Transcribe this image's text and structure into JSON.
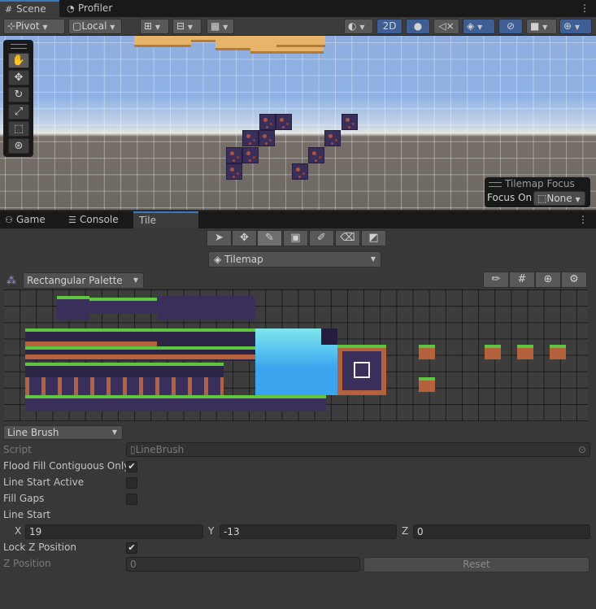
{
  "scene_tabs": [
    {
      "label": "Scene",
      "icon": "grid-icon"
    },
    {
      "label": "Profiler",
      "icon": "profiler-icon"
    }
  ],
  "scene_toolbar": {
    "pivot_label": "Pivot",
    "local_label": "Local",
    "mode_2d_label": "2D"
  },
  "tilemap_focus": {
    "title": "Tilemap Focus",
    "label": "Focus On",
    "value": "None"
  },
  "bottom_tabs": [
    {
      "label": "Game",
      "icon": "gamepad-icon"
    },
    {
      "label": "Console",
      "icon": "console-icon"
    },
    {
      "label": "Tile Palette",
      "icon": ""
    }
  ],
  "palette": {
    "tools": [
      "select-icon",
      "move-icon",
      "brush-icon",
      "box-fill-icon",
      "picker-icon",
      "eraser-icon",
      "fill-icon"
    ],
    "active_tilemap": "Tilemap",
    "palette_name": "Rectangular Palette"
  },
  "inspector": {
    "brush_name": "Line Brush",
    "script_label": "Script",
    "script_value": "LineBrush",
    "flood_fill_label": "Flood Fill Contiguous Only",
    "flood_fill_checked": true,
    "line_start_active_label": "Line Start Active",
    "line_start_active_checked": false,
    "fill_gaps_label": "Fill Gaps",
    "fill_gaps_checked": false,
    "line_start_label": "Line Start",
    "x_label": "X",
    "x_value": "19",
    "y_label": "Y",
    "y_value": "-13",
    "z_label": "Z",
    "z_value": "0",
    "lock_z_label": "Lock Z Position",
    "lock_z_checked": true,
    "z_position_label": "Z Position",
    "z_position_value": "0",
    "reset_label": "Reset"
  }
}
